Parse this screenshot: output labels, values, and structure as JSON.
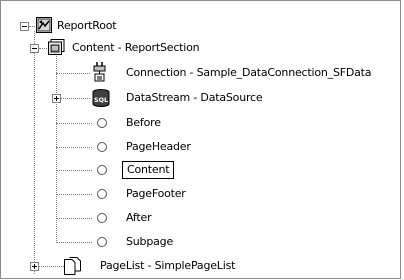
{
  "tree": {
    "root": {
      "label": "ReportRoot"
    },
    "content": {
      "label": "Content - ReportSection"
    },
    "connection": {
      "label": "Connection - Sample_DataConnection_SFData"
    },
    "datastream": {
      "label": "DataStream - DataSource",
      "icon_text": "SQL"
    },
    "bands": [
      {
        "label": "Before"
      },
      {
        "label": "PageHeader"
      },
      {
        "label": "Content"
      },
      {
        "label": "PageFooter"
      },
      {
        "label": "After"
      },
      {
        "label": "Subpage"
      }
    ],
    "pagelist": {
      "label": "PageList - SimplePageList"
    }
  }
}
